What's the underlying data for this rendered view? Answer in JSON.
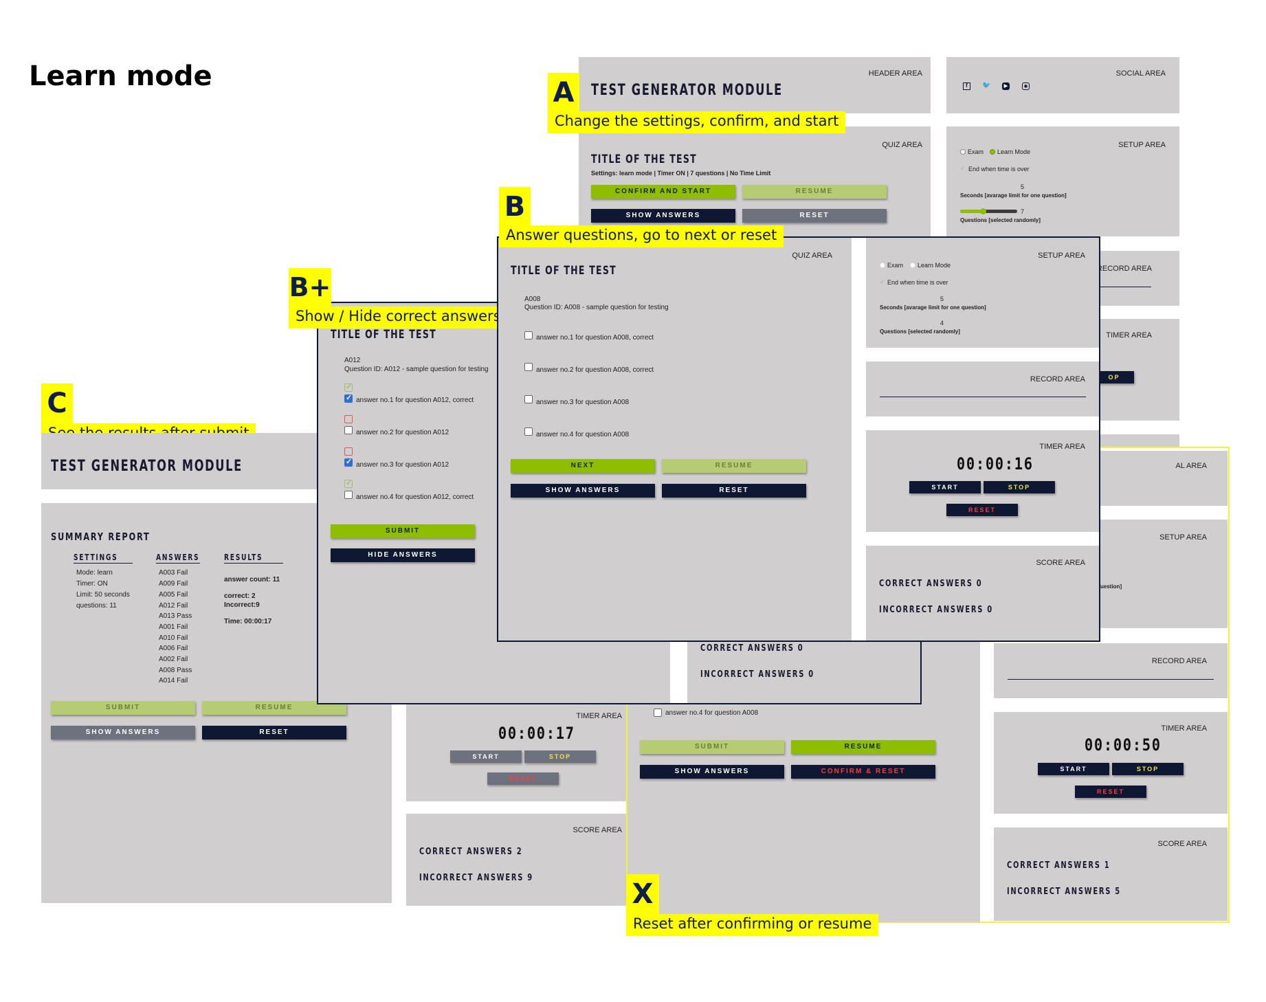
{
  "page_title": "Learn mode",
  "tags": {
    "A": {
      "letter": "A",
      "text": "Change the settings, confirm, and start"
    },
    "B": {
      "letter": "B",
      "text": "Answer questions, go to next or reset"
    },
    "Bplus": {
      "letter": "B+",
      "text": "Show / Hide correct answers"
    },
    "C": {
      "letter": "C",
      "text": "See the results after submit"
    },
    "X": {
      "letter": "X",
      "text": "Reset after confirming or resume"
    }
  },
  "labels": {
    "header_area": "HEADER AREA",
    "social_area": "SOCIAL AREA",
    "quiz_area": "QUIZ AREA",
    "setup_area": "SETUP AREA",
    "record_area": "RECORD AREA",
    "timer_area": "TIMER AREA",
    "score_area": "SCORE AREA",
    "al_area": "AL AREA"
  },
  "app_title": "TEST GENERATOR MODULE",
  "test_title": "TITLE OF THE TEST",
  "buttons": {
    "confirm_start": "CONFIRM AND START",
    "resume": "RESUME",
    "show_answers": "SHOW ANSWERS",
    "hide_answers": "HIDE ANSWERS",
    "reset": "RESET",
    "next": "NEXT",
    "submit": "SUBMIT",
    "start": "START",
    "stop": "STOP",
    "confirm_reset": "CONFIRM & RESET",
    "op": "OP"
  },
  "screen_a": {
    "settings_line": "Settings: learn mode | Timer ON | 7 questions | No Time Limit",
    "setup": {
      "exam": "Exam",
      "learn": "Learn Mode",
      "end_when": "End when time is over",
      "seconds_value": "5",
      "seconds_label": "Seconds [avarage limit for one question]",
      "questions_value": "7",
      "questions_label": "Questions [selected randomly]",
      "slider_fill": 0.4
    }
  },
  "screen_b": {
    "question_code": "A008",
    "question_text": "Question ID: A008 - sample question for testing",
    "answers": [
      "answer no.1 for question A008, correct",
      "answer no.2 for question A008, correct",
      "answer no.3 for question A008",
      "answer no.4 for question A008"
    ],
    "setup": {
      "exam": "Exam",
      "learn": "Learn Mode",
      "end_when": "End when time is over",
      "seconds_value": "5",
      "seconds_label": "Seconds [avarage limit for one question]",
      "questions_value": "4",
      "questions_label": "Questions [selected randomly]"
    },
    "timer": "00:00:16",
    "score": {
      "correct": "CORRECT ANSWERS 0",
      "incorrect": "INCORRECT ANSWERS 0"
    }
  },
  "screen_bplus": {
    "question_code": "A012",
    "question_text": "Question ID: A012 - sample question for testing",
    "answers": [
      "answer no.1 for question A012, correct",
      "answer no.2 for question A012",
      "answer no.3 for question A012",
      "answer no.4 for question A012, correct"
    ],
    "score": {
      "correct": "CORRECT ANSWERS 0",
      "incorrect": "INCORRECT ANSWERS 0"
    }
  },
  "screen_c": {
    "summary_title": "SUMMARY REPORT",
    "col_settings": "SETTINGS",
    "col_answers": "ANSWERS",
    "col_results": "RESULTS",
    "settings": [
      "Mode: learn",
      "Timer: ON",
      "Limit: 50 seconds",
      "questions: 11"
    ],
    "answers": [
      "A003 Fail",
      "A009 Fail",
      "A005 Fail",
      "A012 Fail",
      "A013 Pass",
      "A001 Fail",
      "A010 Fail",
      "A006 Fail",
      "A002 Fail",
      "A008 Pass",
      "A014 Fail"
    ],
    "answer_count": "answer count: 11",
    "correct": "correct: 2",
    "incorrect": "Incorrect:9",
    "time": "Time: 00:00:17",
    "timer": "00:00:17",
    "score": {
      "correct": "CORRECT ANSWERS 2",
      "incorrect": "INCORRECT ANSWERS 9"
    }
  },
  "screen_x": {
    "answer4": "answer no.4 for question A008",
    "setup_partial": "uestion]",
    "timer": "00:00:50",
    "score": {
      "correct": "CORRECT ANSWERS 1",
      "incorrect": "INCORRECT ANSWERS 5"
    }
  }
}
